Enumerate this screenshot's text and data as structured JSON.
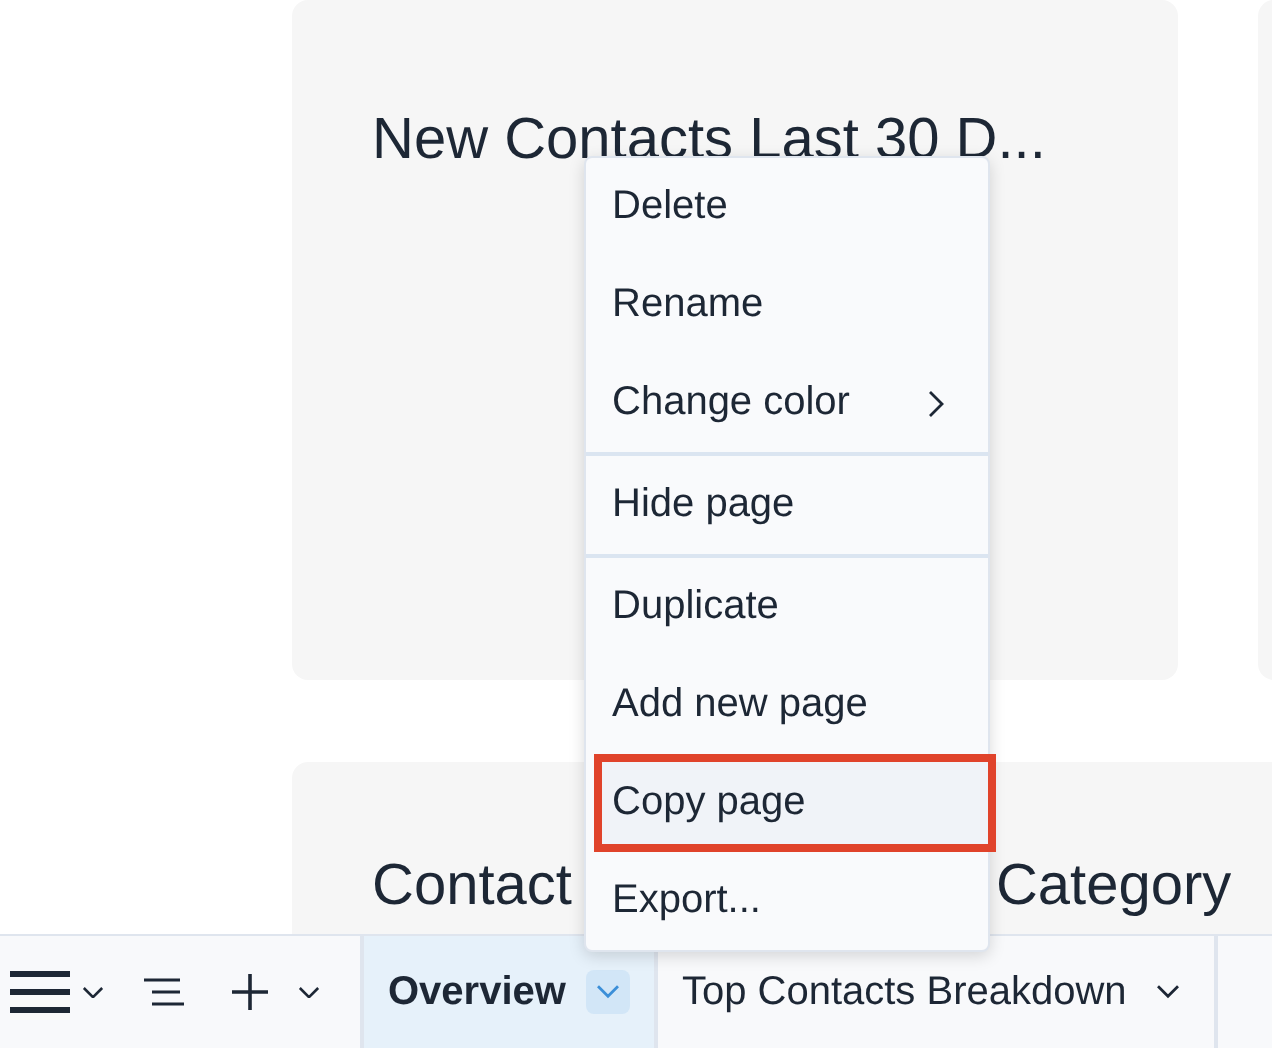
{
  "cards": [
    {
      "title_parts": [
        "New Contacts Last 30 D..."
      ]
    },
    {
      "title_parts": [
        "Contact",
        "Category"
      ]
    }
  ],
  "context_menu": {
    "groups": [
      [
        {
          "label": "Delete",
          "submenu": false,
          "selected": false
        },
        {
          "label": "Rename",
          "submenu": false,
          "selected": false
        },
        {
          "label": "Change color",
          "submenu": true,
          "selected": false
        }
      ],
      [
        {
          "label": "Hide page",
          "submenu": false,
          "selected": false
        }
      ],
      [
        {
          "label": "Duplicate",
          "submenu": false,
          "selected": false
        },
        {
          "label": "Add new page",
          "submenu": false,
          "selected": false
        },
        {
          "label": "Copy page",
          "submenu": false,
          "selected": true
        },
        {
          "label": "Export...",
          "submenu": false,
          "selected": false
        }
      ]
    ]
  },
  "page_tabs": [
    {
      "label": "Overview",
      "selected": true
    },
    {
      "label": "Top Contacts Breakdown",
      "selected": false
    }
  ]
}
